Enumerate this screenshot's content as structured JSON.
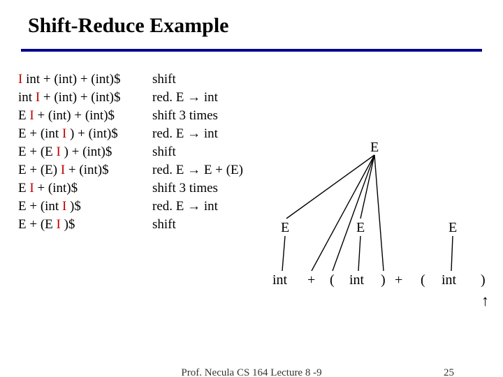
{
  "title": "Shift-Reduce Example",
  "cursor_glyph": "I",
  "steps": [
    {
      "pre": "",
      "post": " int + (int) + (int)$",
      "action": "shift"
    },
    {
      "pre": "int ",
      "post": " + (int) + (int)$",
      "action": "red. E → int"
    },
    {
      "pre": "E ",
      "post": " + (int) + (int)$",
      "action": "shift 3 times"
    },
    {
      "pre": "E + (int ",
      "post": " ) + (int)$",
      "action": "red. E → int"
    },
    {
      "pre": "E + (E ",
      "post": " ) + (int)$",
      "action": "shift"
    },
    {
      "pre": "E + (E) ",
      "post": " + (int)$",
      "action": "red. E → E + (E)"
    },
    {
      "pre": "E ",
      "post": " + (int)$",
      "action": "shift 3 times"
    },
    {
      "pre": "E + (int ",
      "post": " )$",
      "action": "red. E → int"
    },
    {
      "pre": "E + (E ",
      "post": " )$",
      "action": "shift"
    }
  ],
  "tree": {
    "top": "E",
    "mid": [
      "E",
      "E",
      "E"
    ],
    "tokens": [
      "int",
      "+",
      "(",
      "int",
      ")",
      "+",
      "(",
      "int",
      ")"
    ]
  },
  "footer": {
    "center": "Prof. Necula  CS 164  Lecture 8 -9",
    "page": "25"
  }
}
